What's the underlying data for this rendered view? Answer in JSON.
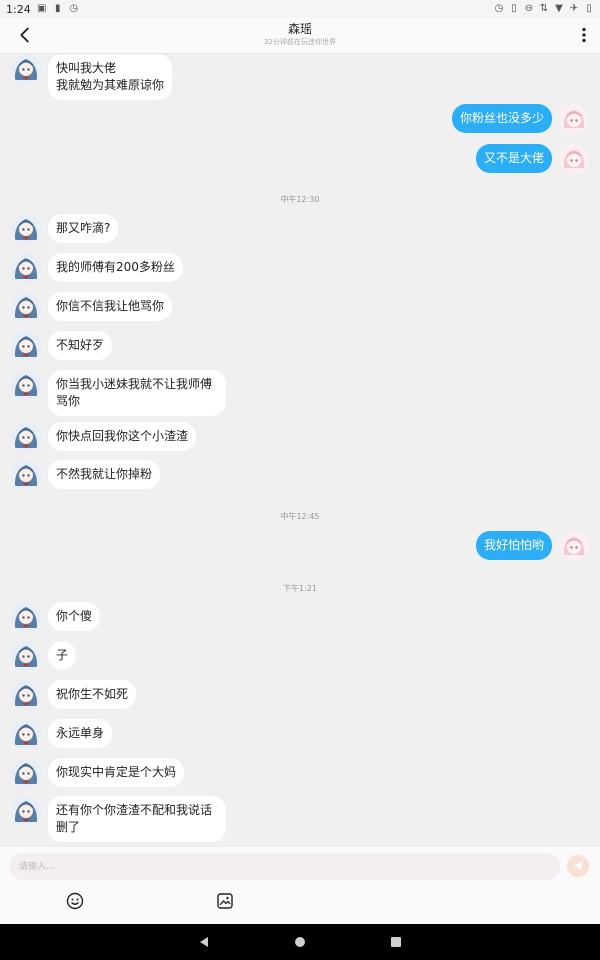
{
  "status_bar": {
    "time": "1:24",
    "battery_text": ""
  },
  "header": {
    "title": "森瑶",
    "subtitle": "32分钟前在玩迷你世界"
  },
  "messages": [
    {
      "side": "left",
      "text": "快叫我大佬\n我就勉为其难原谅你"
    },
    {
      "side": "right",
      "text": "你粉丝也没多少"
    },
    {
      "side": "right",
      "text": "又不是大佬"
    },
    {
      "side": "time",
      "text": "中午12:30"
    },
    {
      "side": "left",
      "text": "那又咋滴?"
    },
    {
      "side": "left",
      "text": "我的师傅有200多粉丝"
    },
    {
      "side": "left",
      "text": "你信不信我让他骂你"
    },
    {
      "side": "left",
      "text": "不知好歹"
    },
    {
      "side": "left",
      "text": "你当我小迷妹我就不让我师傅骂你"
    },
    {
      "side": "left",
      "text": "你快点回我你这个小渣渣"
    },
    {
      "side": "left",
      "text": "不然我就让你掉粉"
    },
    {
      "side": "time",
      "text": "中午12:45"
    },
    {
      "side": "right",
      "text": "我好怕怕哟"
    },
    {
      "side": "time",
      "text": "下午1:21"
    },
    {
      "side": "left",
      "text": "你个傻"
    },
    {
      "side": "left",
      "text": "子"
    },
    {
      "side": "left",
      "text": "祝你生不如死"
    },
    {
      "side": "left",
      "text": "永远单身"
    },
    {
      "side": "left",
      "text": "你现实中肯定是个大妈"
    },
    {
      "side": "left",
      "text": "还有你个你渣渣不配和我说话删了"
    }
  ],
  "input": {
    "placeholder": "请输入..."
  },
  "colors": {
    "my_bubble": "#2baef5",
    "their_bubble": "#ffffff",
    "send_button": "#fbe0d6"
  },
  "icons": {
    "back": "back-arrow-icon",
    "more": "more-vert-icon",
    "emoji": "smiley-icon",
    "image": "image-icon",
    "send": "send-icon"
  }
}
